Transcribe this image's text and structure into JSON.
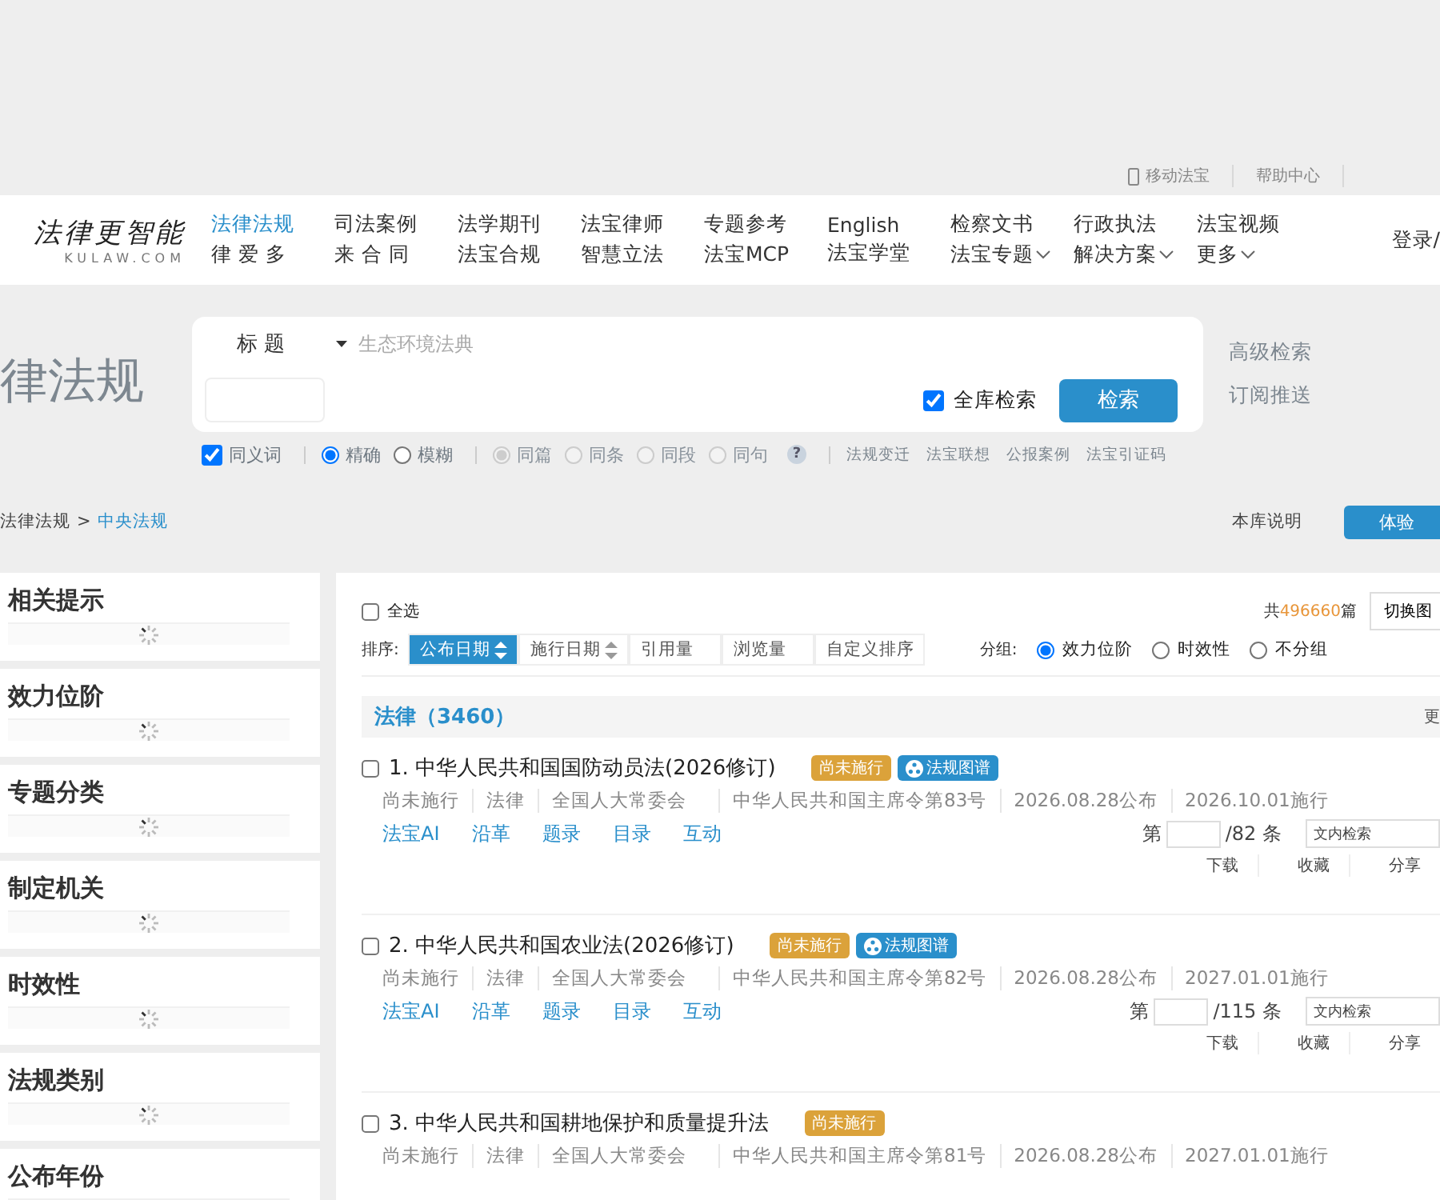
{
  "top_links": [
    "移动法宝",
    "帮助中心"
  ],
  "logo": {
    "text": "法律更智能",
    "sub": "KULAW.COM"
  },
  "nav_columns": [
    {
      "items": [
        {
          "label": "法律法规",
          "selected": true,
          "dropdown": false
        },
        {
          "label": "律 爱 多",
          "selected": false,
          "dropdown": false
        }
      ]
    },
    {
      "items": [
        {
          "label": "司法案例",
          "selected": false,
          "dropdown": false
        },
        {
          "label": "来 合 同",
          "selected": false,
          "dropdown": false
        }
      ]
    },
    {
      "items": [
        {
          "label": "法学期刊",
          "selected": false,
          "dropdown": false
        },
        {
          "label": "法宝合规",
          "selected": false,
          "dropdown": false
        }
      ]
    },
    {
      "items": [
        {
          "label": "法宝律师",
          "selected": false,
          "dropdown": false
        },
        {
          "label": "智慧立法",
          "selected": false,
          "dropdown": false
        }
      ]
    },
    {
      "items": [
        {
          "label": "专题参考",
          "selected": false,
          "dropdown": false
        },
        {
          "label": "法宝MCP",
          "selected": false,
          "dropdown": false
        }
      ]
    },
    {
      "items": [
        {
          "label": "English",
          "selected": false,
          "dropdown": false
        },
        {
          "label": "法宝学堂",
          "selected": false,
          "dropdown": false
        }
      ]
    },
    {
      "items": [
        {
          "label": "检察文书",
          "selected": false,
          "dropdown": false
        },
        {
          "label": "法宝专题",
          "selected": false,
          "dropdown": true
        }
      ]
    },
    {
      "items": [
        {
          "label": "行政执法",
          "selected": false,
          "dropdown": false
        },
        {
          "label": "解决方案",
          "selected": false,
          "dropdown": true
        }
      ]
    },
    {
      "items": [
        {
          "label": "法宝视频",
          "selected": false,
          "dropdown": false
        },
        {
          "label": "更多",
          "selected": false,
          "dropdown": true
        }
      ]
    }
  ],
  "login": "登录/",
  "banner_title": "律法规",
  "search": {
    "field": "标题",
    "placeholder": "生态环境法典",
    "full_library": {
      "label": "全库检索",
      "checked": true
    },
    "button": "检索"
  },
  "side_links": [
    "高级检索",
    "订阅推送"
  ],
  "options": {
    "synonym": {
      "label": "同义词",
      "checked": true
    },
    "match": [
      {
        "label": "精确",
        "selected": true
      },
      {
        "label": "模糊",
        "selected": false
      }
    ],
    "scope": [
      {
        "label": "同篇",
        "selected": true,
        "disabled": true
      },
      {
        "label": "同条",
        "selected": false,
        "disabled": true
      },
      {
        "label": "同段",
        "selected": false,
        "disabled": true
      },
      {
        "label": "同句",
        "selected": false,
        "disabled": true
      }
    ],
    "help": "?",
    "links": [
      "法规变迁",
      "法宝联想",
      "公报案例",
      "法宝引证码"
    ]
  },
  "breadcrumb": {
    "parent": "法律法规",
    "separator": ">",
    "current": "中央法规"
  },
  "library_note": "本库说明",
  "trial_button": "体验",
  "facets": [
    "相关提示",
    "效力位阶",
    "专题分类",
    "制定机关",
    "时效性",
    "法规类别",
    "公布年份"
  ],
  "select_all": {
    "label": "全选",
    "checked": false
  },
  "total": {
    "prefix": "共",
    "count": "496660",
    "suffix": "篇"
  },
  "toggle_button": "切换图",
  "sort": {
    "label": "排序:",
    "options": [
      {
        "label": "公布日期",
        "selected": true,
        "sortable": true
      },
      {
        "label": "施行日期",
        "selected": false,
        "sortable": true
      },
      {
        "label": "引用量",
        "selected": false,
        "sortable": false
      },
      {
        "label": "浏览量",
        "selected": false,
        "sortable": false
      },
      {
        "label": "自定义排序",
        "selected": false,
        "sortable": false
      }
    ]
  },
  "group": {
    "label": "分组:",
    "options": [
      {
        "label": "效力位阶",
        "selected": true
      },
      {
        "label": "时效性",
        "selected": false
      },
      {
        "label": "不分组",
        "selected": false
      }
    ]
  },
  "group_header": {
    "title": "法律（3460）",
    "more": "更"
  },
  "results": [
    {
      "title": "1. 中华人民共和国国防动员法(2026修订)",
      "checked": false,
      "badges": [
        {
          "label": "尚未施行",
          "kind": "status"
        },
        {
          "label": "法规图谱",
          "kind": "graph"
        }
      ],
      "meta": [
        "尚未施行",
        "法律",
        "全国人大常委会",
        "中华人民共和国主席令第83号",
        "2026.08.28公布",
        "2026.10.01施行"
      ],
      "links": [
        "法宝AI",
        "沿革",
        "题录",
        "目录",
        "互动"
      ],
      "page_prefix": "第",
      "page_total": "/82 条",
      "search_placeholder": "文内检索",
      "actions": [
        "下载",
        "收藏",
        "分享"
      ]
    },
    {
      "title": "2. 中华人民共和国农业法(2026修订)",
      "checked": false,
      "badges": [
        {
          "label": "尚未施行",
          "kind": "status"
        },
        {
          "label": "法规图谱",
          "kind": "graph"
        }
      ],
      "meta": [
        "尚未施行",
        "法律",
        "全国人大常委会",
        "中华人民共和国主席令第82号",
        "2026.08.28公布",
        "2027.01.01施行"
      ],
      "links": [
        "法宝AI",
        "沿革",
        "题录",
        "目录",
        "互动"
      ],
      "page_prefix": "第",
      "page_total": "/115 条",
      "search_placeholder": "文内检索",
      "actions": [
        "下载",
        "收藏",
        "分享"
      ]
    },
    {
      "title": "3. 中华人民共和国耕地保护和质量提升法",
      "checked": false,
      "badges": [
        {
          "label": "尚未施行",
          "kind": "status"
        }
      ],
      "meta": [
        "尚未施行",
        "法律",
        "全国人大常委会",
        "中华人民共和国主席令第81号",
        "2026.08.28公布",
        "2027.01.01施行"
      ]
    }
  ]
}
